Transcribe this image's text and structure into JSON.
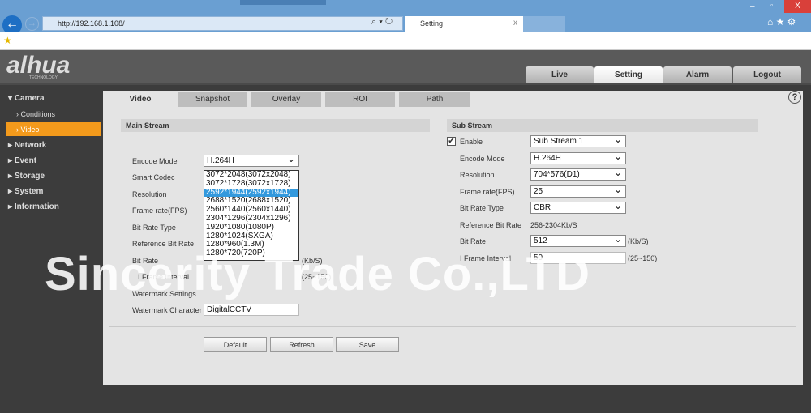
{
  "browser": {
    "url": "http://192.168.1.108/",
    "tab_title": "Setting",
    "tab_close": "x",
    "min": "–",
    "max": "▫",
    "close": "X"
  },
  "header": {
    "logo": "alhua",
    "logo_sub": "TECHNOLOGY",
    "nav": [
      "Live",
      "Setting",
      "Alarm",
      "Logout"
    ],
    "active_nav": "Setting"
  },
  "sidebar": {
    "camera": "Camera",
    "conditions": "Conditions",
    "video": "Video",
    "items": [
      "Network",
      "Event",
      "Storage",
      "System",
      "Information"
    ]
  },
  "tabs": [
    "Video",
    "Snapshot",
    "Overlay",
    "ROI",
    "Path"
  ],
  "help": "?",
  "main_stream": {
    "title": "Main Stream",
    "labels": [
      "Encode Mode",
      "Smart Codec",
      "Resolution",
      "Frame rate(FPS)",
      "Bit Rate Type",
      "Reference Bit Rate",
      "Bit Rate",
      "I Frame Interval",
      "Watermark Settings",
      "Watermark Character"
    ],
    "encode_mode": "H.264H",
    "bitrate_unit": "(Kb/S)",
    "iframe_range": "(25~150)",
    "watermark_character": "DigitalCCTV",
    "resolution_options": [
      "3072*2048(3072x2048)",
      "3072*1728(3072x1728)",
      "2592*1944(2592x1944)",
      "2688*1520(2688x1520)",
      "2560*1440(2560x1440)",
      "2304*1296(2304x1296)",
      "1920*1080(1080P)",
      "1280*1024(SXGA)",
      "1280*960(1.3M)",
      "1280*720(720P)"
    ],
    "resolution_selected_index": 2
  },
  "sub_stream": {
    "title": "Sub Stream",
    "enable_label": "Enable",
    "enabled": true,
    "stream": "Sub Stream 1",
    "labels": [
      "Encode Mode",
      "Resolution",
      "Frame rate(FPS)",
      "Bit Rate Type",
      "Reference Bit Rate",
      "Bit Rate",
      "I Frame Interval"
    ],
    "encode_mode": "H.264H",
    "resolution": "704*576(D1)",
    "frame_rate": "25",
    "bit_rate_type": "CBR",
    "reference_bit_rate": "256-2304Kb/S",
    "bit_rate": "512",
    "bitrate_unit": "(Kb/S)",
    "iframe_interval": "50",
    "iframe_range": "(25~150)"
  },
  "buttons": {
    "default": "Default",
    "refresh": "Refresh",
    "save": "Save"
  },
  "watermark_overlay": "Sincerity Trade Co.,LTD"
}
